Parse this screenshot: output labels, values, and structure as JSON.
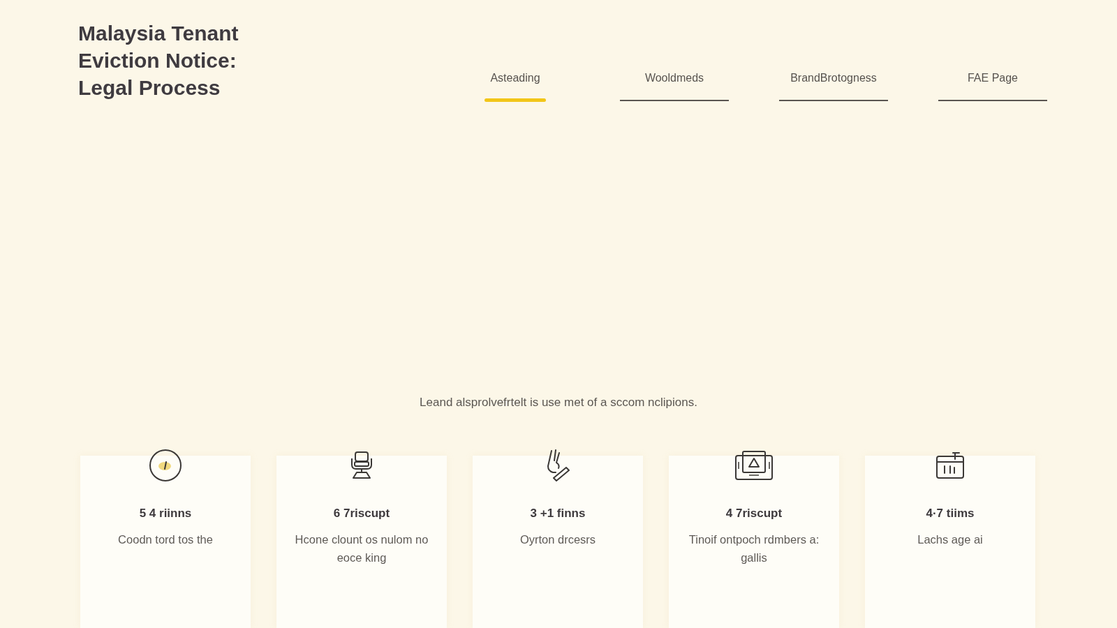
{
  "header": {
    "title": "Malaysia Tenant Eviction Notice: Legal Process"
  },
  "tabs": [
    {
      "label": "Asteading",
      "selected": true
    },
    {
      "label": "Wooldmeds",
      "selected": false
    },
    {
      "label": "BrandBrotogness",
      "selected": false
    },
    {
      "label": "FAE Page",
      "selected": false
    }
  ],
  "caption": "Leand alsprolvefrtelt is use met of a sccom nclipions.",
  "cards": [
    {
      "kind": "dial",
      "heading": "5 4 riinns",
      "description": "Coodn tord tos the"
    },
    {
      "kind": "chair",
      "heading": "6 7riscupt",
      "description": "Hcone clount os nulom no eoce king"
    },
    {
      "kind": "hand",
      "heading": "3 +1 finns",
      "description": "Oyrton drcesrs"
    },
    {
      "kind": "frame",
      "heading": "4 7riscupt",
      "description": "Tinoif ontpoch rdmbers a: gallis"
    },
    {
      "kind": "calendar",
      "heading": "4·7 tiims",
      "description": "Lachs age ai"
    }
  ]
}
